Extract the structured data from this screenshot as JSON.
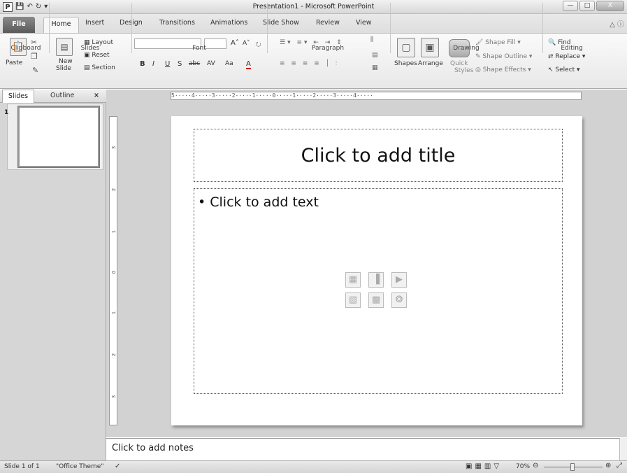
{
  "window": {
    "title": "Presentation1 - Microsoft PowerPoint",
    "app_icon": "P",
    "qat_icons": [
      "save-icon",
      "undo-icon",
      "redo-icon",
      "customize-icon"
    ],
    "buttons": {
      "minimize": "—",
      "maximize": "□",
      "close": "X"
    }
  },
  "tabs": {
    "file": "File",
    "home": "Home",
    "items": [
      "Insert",
      "Design",
      "Transitions",
      "Animations",
      "Slide Show",
      "Review",
      "View"
    ]
  },
  "ribbon": {
    "clipboard": {
      "paste": "Paste",
      "label": "Clipboard"
    },
    "slides": {
      "new_slide_1": "New",
      "new_slide_2": "Slide",
      "layout": "Layout",
      "reset": "Reset",
      "section": "Section",
      "label": "Slides"
    },
    "font": {
      "label": "Font",
      "bold": "B",
      "italic": "I",
      "underline": "U",
      "shadow": "S",
      "strike": "abc",
      "spacing": "AV",
      "case": "Aa",
      "color": "A",
      "grow": "A",
      "shrink": "A"
    },
    "paragraph": {
      "label": "Paragraph"
    },
    "drawing": {
      "shapes": "Shapes",
      "arrange": "Arrange",
      "quick_styles_1": "Quick",
      "quick_styles_2": "Styles",
      "shape_fill": "Shape Fill",
      "shape_outline": "Shape Outline",
      "shape_effects": "Shape Effects",
      "label": "Drawing"
    },
    "editing": {
      "find": "Find",
      "replace": "Replace",
      "select": "Select",
      "label": "Editing"
    }
  },
  "side_pane": {
    "tab_slides": "Slides",
    "tab_outline": "Outline",
    "close": "×",
    "slide_number": "1"
  },
  "ruler": {
    "horizontal": "5·····4·····3·····2·····1·····0·····1·····2·····3·····4·····",
    "vertical_marks": [
      "3",
      "2",
      "1",
      "0",
      "1",
      "2",
      "3"
    ]
  },
  "slide": {
    "title_placeholder": "Click to add title",
    "body_placeholder": "Click to add text"
  },
  "notes": {
    "placeholder": "Click to add notes"
  },
  "status": {
    "slide_info": "Slide 1 of 1",
    "theme": "\"Office Theme\"",
    "zoom": "70%"
  }
}
